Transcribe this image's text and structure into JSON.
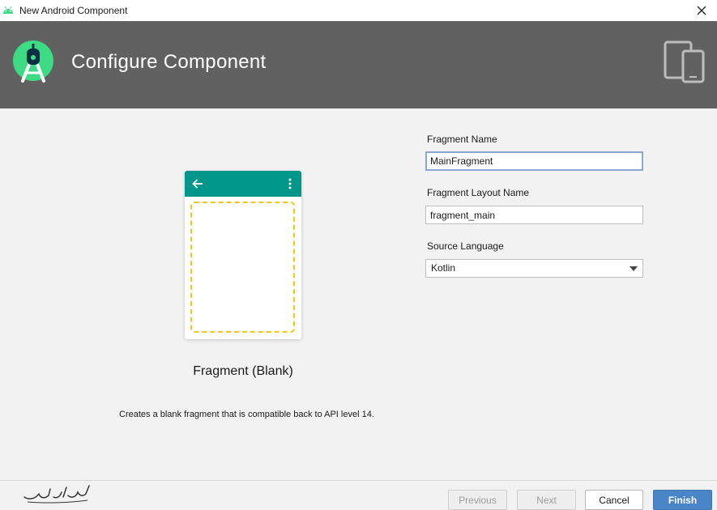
{
  "window": {
    "title": "New Android Component",
    "app_icon": "android-icon",
    "close_icon": "close-icon"
  },
  "header": {
    "title": "Configure Component",
    "logo_icon": "android-studio-logo-icon",
    "devices_icon": "devices-icon",
    "background": "#616161"
  },
  "preview": {
    "name": "Fragment (Blank)",
    "description": "Creates a blank fragment that is compatible back to API level 14.",
    "appbar_color": "#00968a",
    "frame_color": "#f5c518"
  },
  "form": {
    "fragment_name": {
      "label": "Fragment Name",
      "value": "MainFragment"
    },
    "layout_name": {
      "label": "Fragment Layout Name",
      "value": "fragment_main"
    },
    "source_language": {
      "label": "Source Language",
      "value": "Kotlin"
    }
  },
  "footer": {
    "signature": "نیکلاس آکادمی",
    "previous_label": "Previous",
    "next_label": "Next",
    "cancel_label": "Cancel",
    "finish_label": "Finish",
    "accent": "#4a86c7"
  }
}
